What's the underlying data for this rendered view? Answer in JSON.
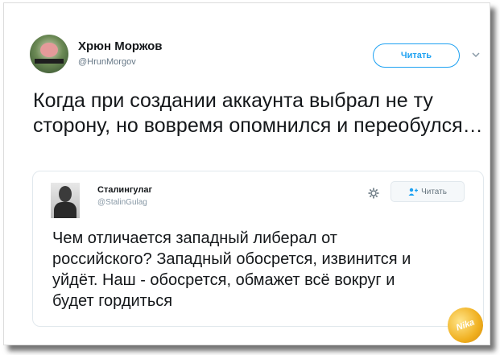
{
  "tweet": {
    "author_name": "Хрюн Моржов",
    "author_handle": "@HrunMorgov",
    "follow_label": "Читать",
    "text": "Когда при создании аккаунта выбрал не ту сторону, но вовремя опомнился и переобулся…"
  },
  "quoted": {
    "author_name": "Сталингулаг",
    "author_handle": "@StalinGulag",
    "follow_label": "Читать",
    "text": "Чем отличается западный либерал от российского? Западный обосрется, извинится и уйдёт. Наш - обосрется, обмажет всё вокруг и будет гордиться"
  },
  "colors": {
    "accent": "#1da1f2",
    "text": "#14171a",
    "muted": "#657786"
  },
  "icons": [
    "avatar-pig",
    "chevron-down-icon",
    "gear-icon",
    "add-user-icon",
    "watermark-logo"
  ]
}
